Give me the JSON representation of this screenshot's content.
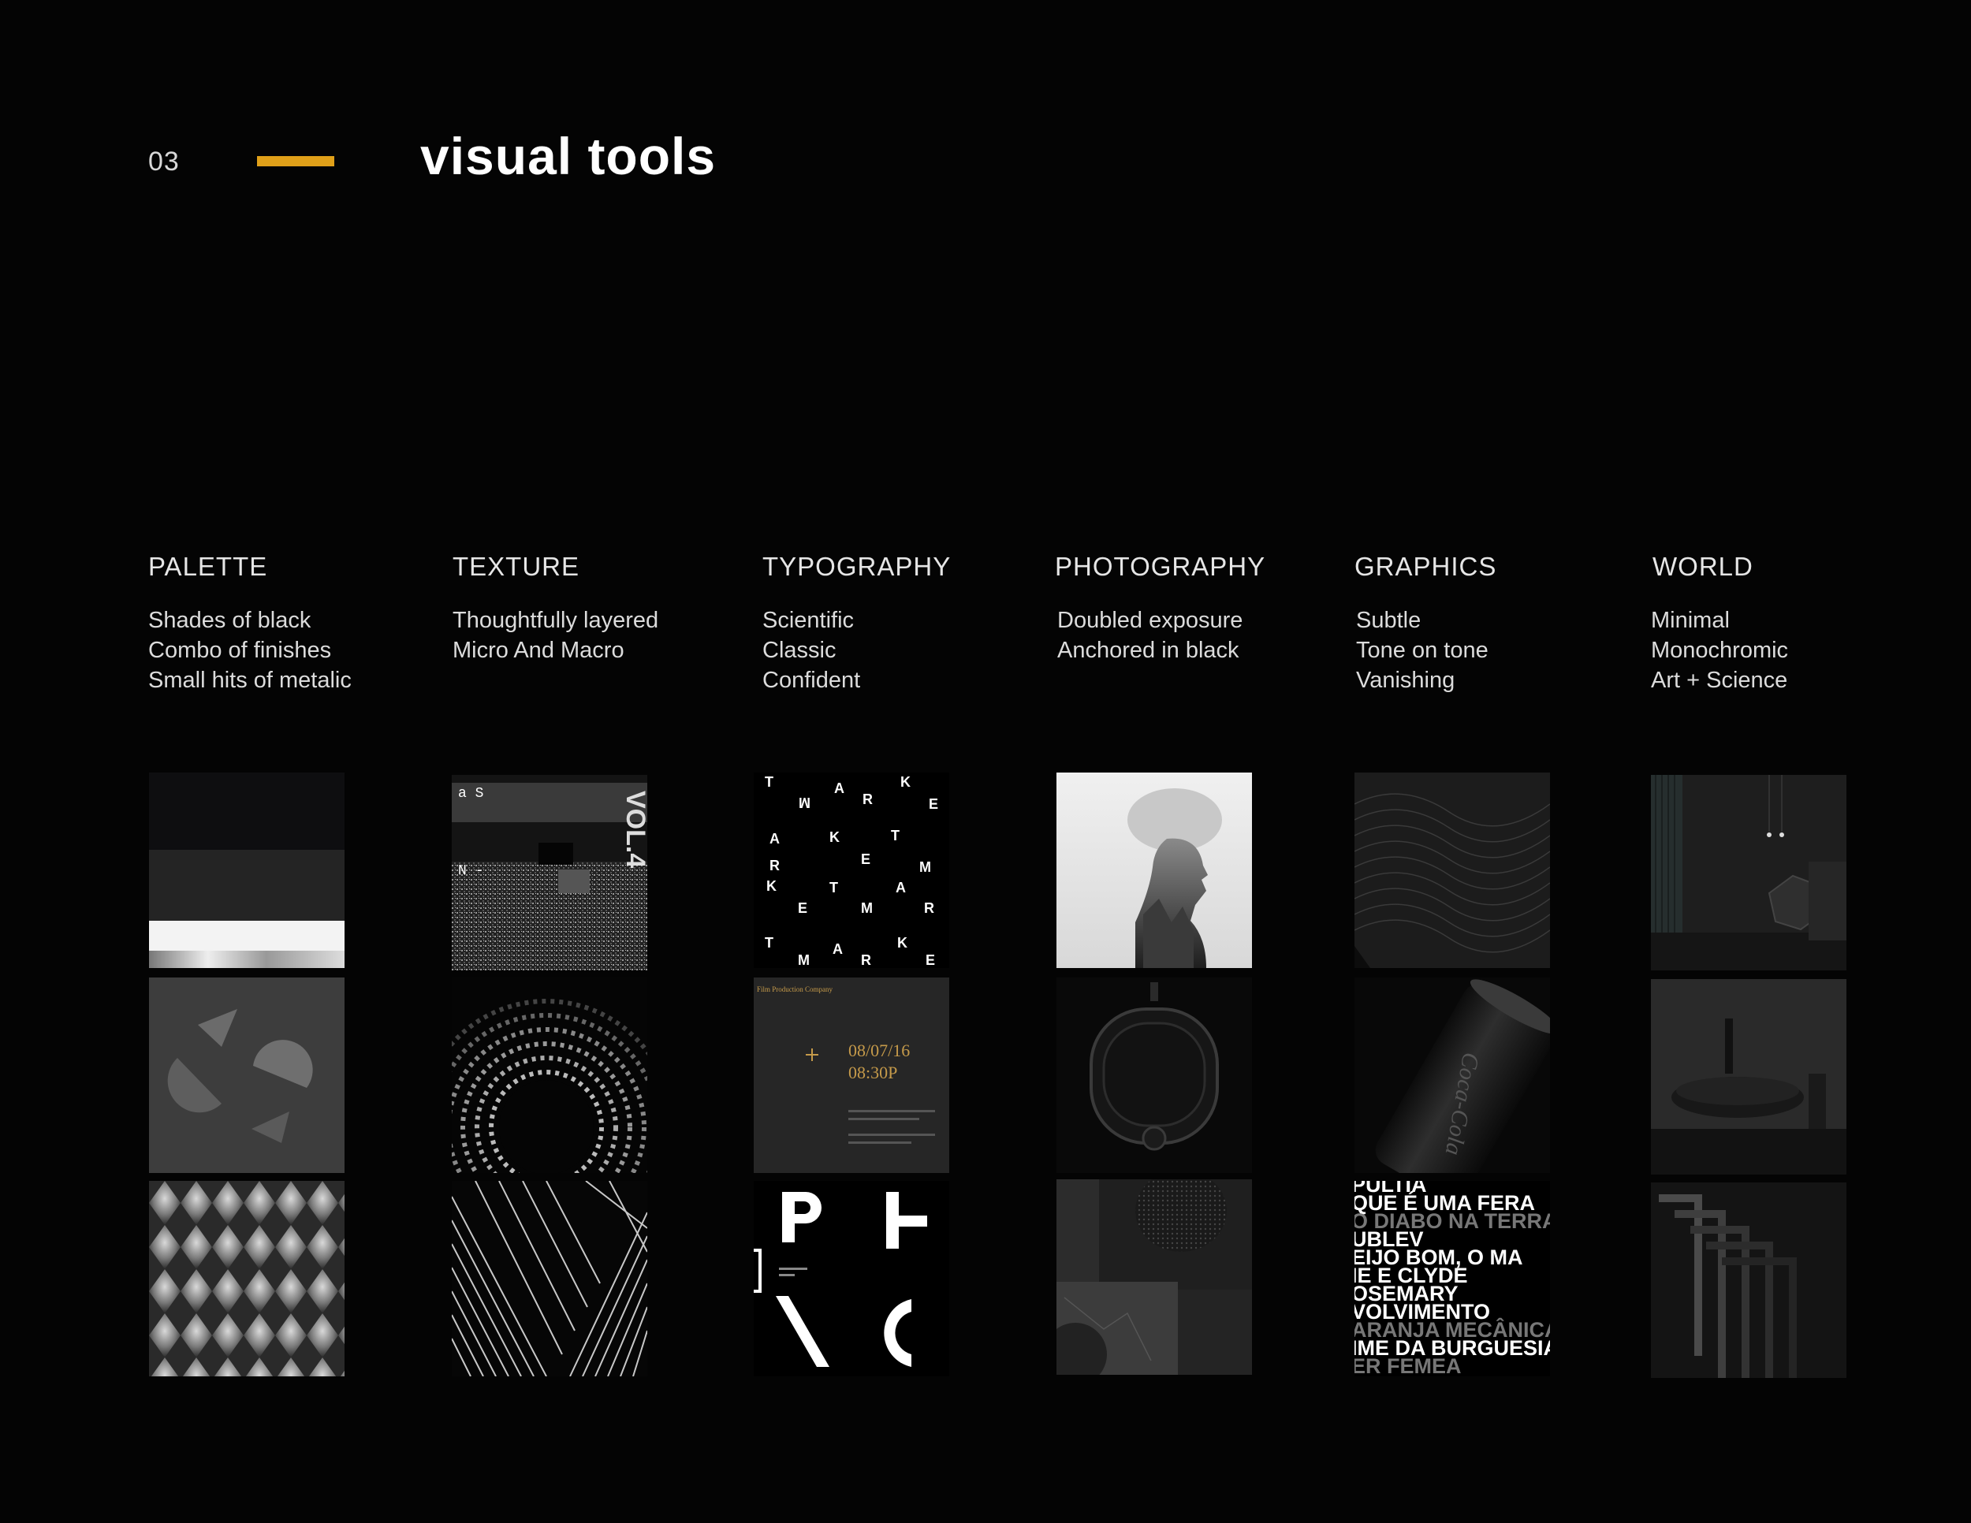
{
  "header": {
    "page_number": "03",
    "title": "visual tools",
    "accent_color": "#e0a019"
  },
  "columns": [
    {
      "id": "palette",
      "heading": "PALETTE",
      "lines": [
        "Shades of black",
        "Combo of finishes",
        "Small hits of metalic"
      ]
    },
    {
      "id": "texture",
      "heading": "TEXTURE",
      "lines": [
        "Thoughtfully layered",
        "Micro And Macro"
      ]
    },
    {
      "id": "typography",
      "heading": "TYPOGRAPHY",
      "lines": [
        "Scientific",
        "Classic",
        "Confident"
      ]
    },
    {
      "id": "photography",
      "heading": "PHOTOGRAPHY",
      "lines": [
        "Doubled exposure",
        "Anchored in black"
      ]
    },
    {
      "id": "graphics",
      "heading": "GRAPHICS",
      "lines": [
        "Subtle",
        "Tone on tone",
        "Vanishing"
      ]
    },
    {
      "id": "world",
      "heading": "WORLD",
      "lines": [
        "Minimal",
        "Monochromic",
        "Art + Science"
      ]
    }
  ],
  "tiles": {
    "texture_1": {
      "text_a": "a S",
      "text_b": "N -",
      "text_c": "VOL.4"
    },
    "typography_2": {
      "date": "08/07/16",
      "time": "08:30P",
      "company": "Film Production Company"
    },
    "graphics_1": {
      "can_text": "Coca-Cola"
    },
    "graphics_3": {
      "lines": [
        "PULTIA",
        "QUE É UMA FERA",
        "O DIABO NA TERRA",
        "UBLEV",
        "EIJO  BOM, O MA",
        "IE E CLYDE",
        "OSEMARY",
        "VOLVIMENTO",
        "ARANJA MECÂNICA",
        "IME DA BURGUESIA",
        "ER FEMEA"
      ]
    }
  }
}
